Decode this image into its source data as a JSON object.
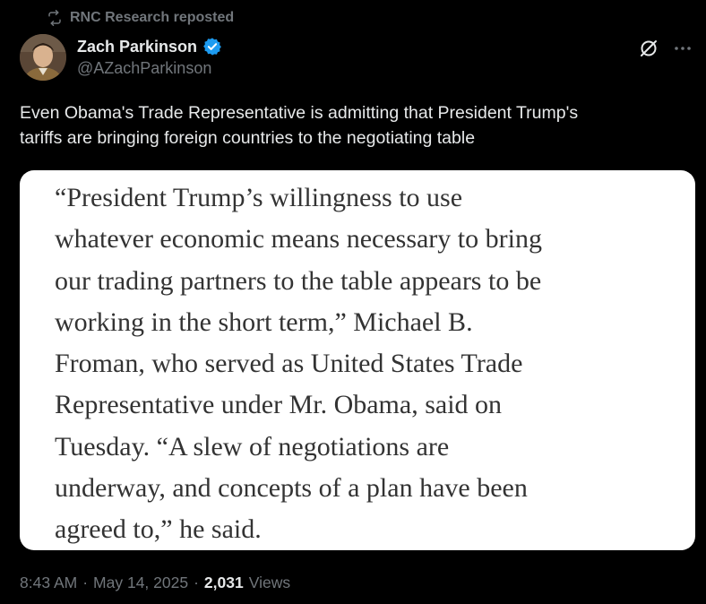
{
  "repost": {
    "icon": "repost-icon",
    "label": "RNC Research reposted"
  },
  "author": {
    "name": "Zach Parkinson",
    "handle": "@AZachParkinson",
    "verified": true,
    "verified_color": "#1d9bf0"
  },
  "actions": {
    "grok_icon": "grok-icon",
    "more_icon": "more-icon"
  },
  "tweet": {
    "text": "Even Obama's Trade Representative is admitting that President Trump's\ntariffs are bringing foreign countries to the negotiating table"
  },
  "media": {
    "quote": "“President Trump’s willingness to use\nwhatever economic means necessary to bring\nour trading partners to the table appears to be\nworking in the short term,” Michael B.\nFroman, who served as United States Trade\nRepresentative under Mr. Obama, said on\nTuesday. “A slew of negotiations are\nunderway, and concepts of a plan have been\nagreed to,” he said."
  },
  "meta": {
    "time": "8:43 AM",
    "separator": "·",
    "date": "May 14, 2025",
    "views_count": "2,031",
    "views_label": "Views"
  },
  "colors": {
    "background": "#000000",
    "primary_text": "#e7e9ea",
    "secondary_text": "#71767b",
    "card_background": "#ffffff",
    "card_text": "#333333"
  }
}
